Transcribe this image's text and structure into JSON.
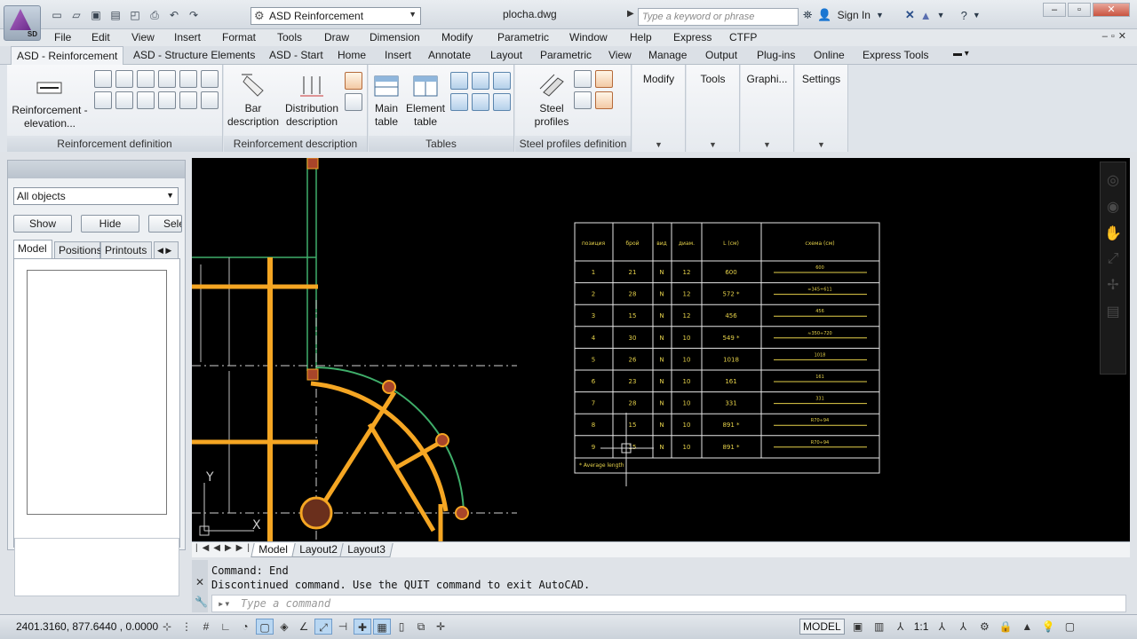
{
  "window": {
    "title": "plocha.dwg",
    "workspace": "ASD Reinforcement",
    "search_placeholder": "Type a keyword or phrase",
    "sign_in": "Sign In",
    "app_badge": "SD"
  },
  "menu": [
    "File",
    "Edit",
    "View",
    "Insert",
    "Format",
    "Tools",
    "Draw",
    "Dimension",
    "Modify",
    "Parametric",
    "Window",
    "Help",
    "Express",
    "CTFP"
  ],
  "ribbon_tabs": [
    "ASD - Reinforcement",
    "ASD - Structure Elements",
    "ASD - Start",
    "Home",
    "Insert",
    "Annotate",
    "Layout",
    "Parametric",
    "View",
    "Manage",
    "Output",
    "Plug-ins",
    "Online",
    "Express Tools"
  ],
  "ribbon": {
    "reinf_def": {
      "title": "Reinforcement definition",
      "big_label": "Reinforcement - elevation..."
    },
    "reinf_desc": {
      "title": "Reinforcement description",
      "bar": "Bar description",
      "dist": "Distribution description"
    },
    "tables": {
      "title": "Tables",
      "main": "Main table",
      "element": "Element table"
    },
    "steel": {
      "title": "Steel profiles definition",
      "label": "Steel profiles"
    },
    "dropdowns": [
      "Modify",
      "Tools",
      "Graphi...",
      "Settings"
    ]
  },
  "palette": {
    "filter": "All objects",
    "show": "Show",
    "hide": "Hide",
    "select": "Sele",
    "tabs": [
      "Model",
      "Positions",
      "Printouts"
    ]
  },
  "table": {
    "headers": [
      "позиция",
      "брой",
      "вид",
      "диам.",
      "L (см)",
      "схема (см)"
    ],
    "rows": [
      {
        "pos": "1",
        "count": "21",
        "type": "N",
        "dia": "12",
        "len": "600",
        "shape": "600"
      },
      {
        "pos": "2",
        "count": "28",
        "type": "N",
        "dia": "12",
        "len": "572 *",
        "shape": "≈345÷611"
      },
      {
        "pos": "3",
        "count": "15",
        "type": "N",
        "dia": "12",
        "len": "456",
        "shape": "456"
      },
      {
        "pos": "4",
        "count": "30",
        "type": "N",
        "dia": "10",
        "len": "549 *",
        "shape": "≈350÷720"
      },
      {
        "pos": "5",
        "count": "26",
        "type": "N",
        "dia": "10",
        "len": "1018",
        "shape": "1018"
      },
      {
        "pos": "6",
        "count": "23",
        "type": "N",
        "dia": "10",
        "len": "161",
        "shape": "161"
      },
      {
        "pos": "7",
        "count": "28",
        "type": "N",
        "dia": "10",
        "len": "331",
        "shape": "331"
      },
      {
        "pos": "8",
        "count": "15",
        "type": "N",
        "dia": "10",
        "len": "891 *",
        "shape": "R70÷94"
      },
      {
        "pos": "9",
        "count": "15",
        "type": "N",
        "dia": "10",
        "len": "891 *",
        "shape": "R70÷94"
      }
    ],
    "footnote": "* Average length"
  },
  "layout_tabs": [
    "Model",
    "Layout2",
    "Layout3"
  ],
  "command": {
    "history": [
      "Command: End",
      "Discontinued command. Use the QUIT command to exit AutoCAD."
    ],
    "placeholder": "Type a command"
  },
  "status": {
    "coords": "2401.3160, 877.6440 , 0.0000",
    "model": "MODEL",
    "scale": "1:1"
  }
}
